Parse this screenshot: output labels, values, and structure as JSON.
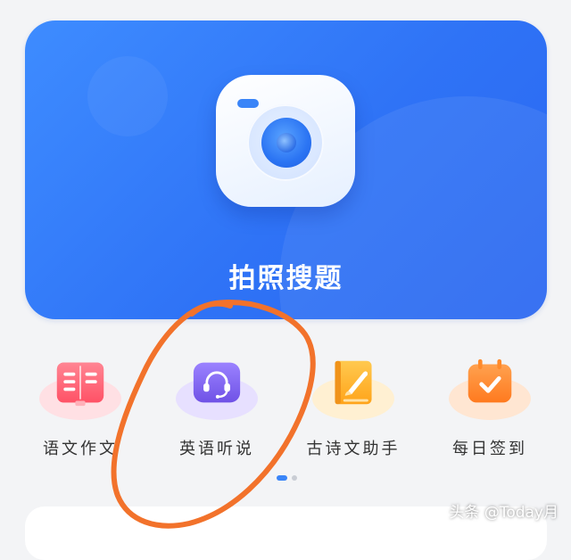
{
  "banner": {
    "title": "拍照搜题",
    "icon": "camera-icon"
  },
  "features": [
    {
      "label": "语文作文",
      "icon": "book-icon",
      "color": "#ff6b7a",
      "glow": "#ffe0e4"
    },
    {
      "label": "英语听说",
      "icon": "headset-icon",
      "color": "#8a6cf0",
      "glow": "#e7e0ff"
    },
    {
      "label": "古诗文助手",
      "icon": "poem-book-icon",
      "color": "#ffb02e",
      "glow": "#fff0d2"
    },
    {
      "label": "每日签到",
      "icon": "calendar-check-icon",
      "color": "#ff8a2b",
      "glow": "#ffe6d2"
    }
  ],
  "pager": {
    "active_index": 0,
    "count": 2
  },
  "watermark": "头条 @Today月",
  "colors": {
    "accent": "#3a85f8",
    "annotation": "#f2722b"
  }
}
